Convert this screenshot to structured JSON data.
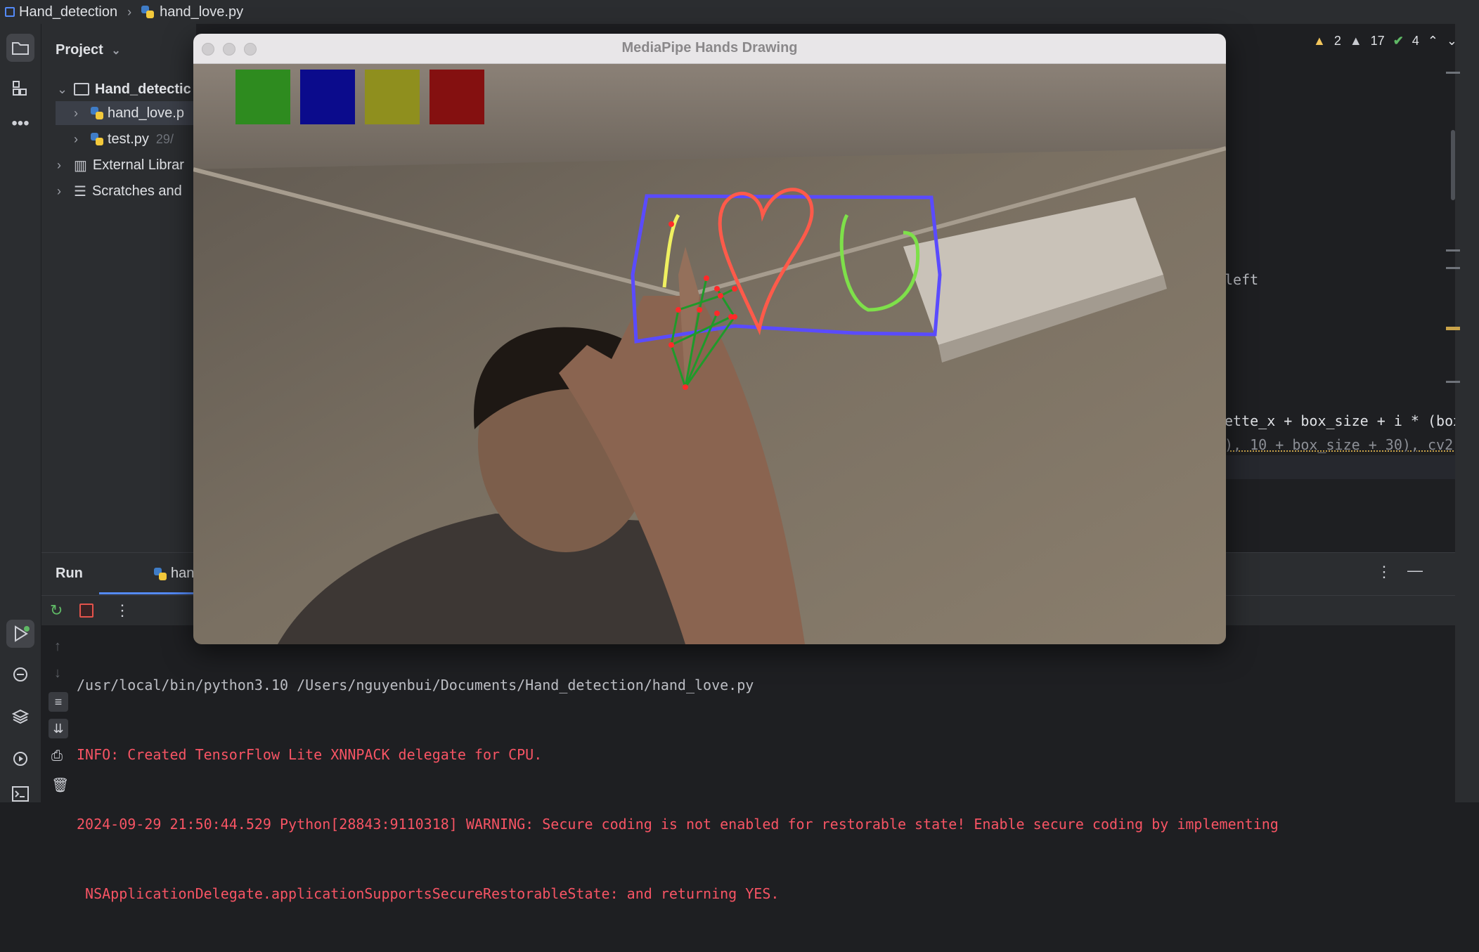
{
  "breadcrumb": {
    "project": "Hand_detection",
    "file": "hand_love.py"
  },
  "project_panel": {
    "header": "Project",
    "items": [
      {
        "label": "Hand_detectic",
        "kind": "folder",
        "meta": ""
      },
      {
        "label": "hand_love.p",
        "kind": "python",
        "meta": ""
      },
      {
        "label": "test.py",
        "kind": "python",
        "meta": "29/"
      },
      {
        "label": "External Librar",
        "kind": "library",
        "meta": ""
      },
      {
        "label": "Scratches and",
        "kind": "scratch",
        "meta": ""
      }
    ]
  },
  "inspections": {
    "warnings": "2",
    "weak_warnings": "17",
    "ok": "4"
  },
  "editor_fragments": {
    "line1": "left",
    "line2": "ette_x + box_size + i * (box",
    "line3": "), 10 + box_size + 30), cv2."
  },
  "camera_window": {
    "title": "MediaPipe Hands Drawing",
    "palette": [
      "#2e8b1f",
      "#0b0b8c",
      "#8f8f1e",
      "#841010"
    ],
    "stroke_colors": {
      "frame": "#5a4bff",
      "heart": "#ff5a4a",
      "u": "#7ee04a",
      "line": "#f0f060",
      "skeleton": "#1f9a2a",
      "joints": "#ff2a2a"
    }
  },
  "run_panel": {
    "label": "Run",
    "tab": "hand_love",
    "console": [
      {
        "text": "/usr/local/bin/python3.10 /Users/nguyenbui/Documents/Hand_detection/hand_love.py",
        "kind": "plain"
      },
      {
        "text": "INFO: Created TensorFlow Lite XNNPACK delegate for CPU.",
        "kind": "err"
      },
      {
        "text": "2024-09-29 21:50:44.529 Python[28843:9110318] WARNING: Secure coding is not enabled for restorable state! Enable secure coding by implementing",
        "kind": "err"
      },
      {
        "text": " NSApplicationDelegate.applicationSupportsSecureRestorableState: and returning YES.",
        "kind": "err"
      }
    ]
  }
}
